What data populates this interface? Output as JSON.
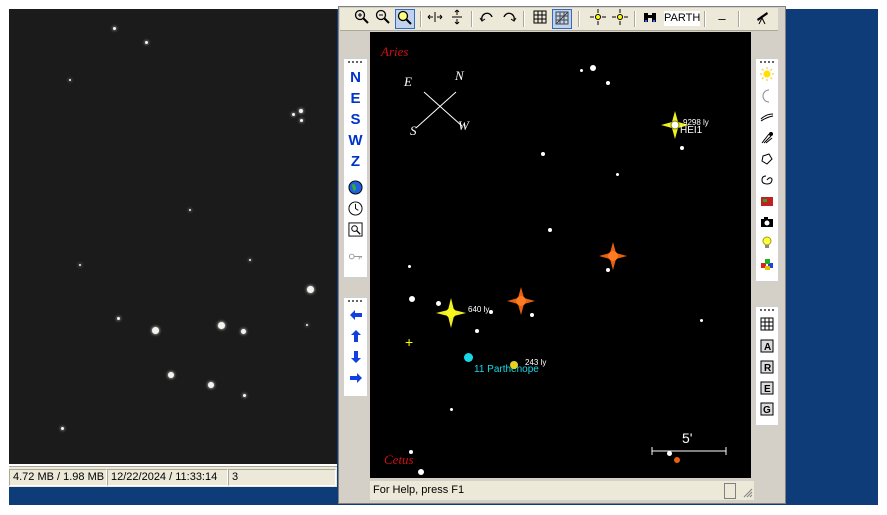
{
  "photo_status": {
    "file_size": "4.72 MB / 1.98 MB",
    "datetime": "12/22/2024 / 11:33:14",
    "count": "3"
  },
  "toolbar": {
    "search_text": "PARTH",
    "minus_label": "–"
  },
  "direction_buttons": [
    "N",
    "E",
    "S",
    "W",
    "Z"
  ],
  "sky": {
    "constellation_top": "Aries",
    "constellation_bottom": "Cetus",
    "compass": {
      "n": "N",
      "e": "E",
      "s": "S",
      "w": "W"
    },
    "labels": {
      "star_far": "9298 ly",
      "hei": "HEI1",
      "star_640": "640 ly",
      "star_243": "243 ly",
      "asteroid": "11 Parthenope"
    },
    "scale_label": "5'"
  },
  "status": {
    "help": "For Help, press F1"
  },
  "colors": {
    "constellation": "#d01010",
    "asteroid": "#18d8e8",
    "yellow_star": "#f0f020",
    "orange_star": "#e86010",
    "window_blue": "#0e3c78"
  },
  "icons": {
    "toolbar": [
      "zoom-in-icon",
      "zoom-out-icon",
      "zoom-fit-icon",
      "flip-horizontal-icon",
      "flip-vertical-icon",
      "rotate-cw-icon",
      "rotate-ccw-icon",
      "grid-icon",
      "grid-alt-icon",
      "center-icon",
      "center-alt-icon",
      "binoculars-icon",
      "telescope-icon"
    ],
    "left": [
      "globe-icon",
      "clock-icon",
      "magnifier-icon",
      "key-icon"
    ],
    "arrows": [
      "arrow-left-icon",
      "arrow-up-icon",
      "arrow-down-icon",
      "arrow-right-icon"
    ],
    "right": [
      "sun-icon",
      "moon-icon",
      "comet-icon",
      "asteroid-icon",
      "planet-icon",
      "galaxy-icon",
      "image-icon",
      "camera-icon",
      "bulb-icon",
      "color-icon",
      "table-icon",
      "label-a-icon",
      "label-r-icon",
      "label-e-icon",
      "label-g-icon"
    ]
  }
}
